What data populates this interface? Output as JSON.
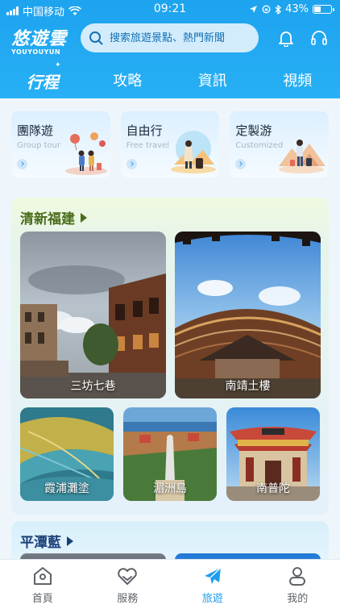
{
  "status_bar": {
    "carrier": "中国移动",
    "time": "09:21",
    "battery": "43%",
    "battery_level": 0.43
  },
  "app": {
    "name": "悠遊雲",
    "sub": "YOUYOUYUN"
  },
  "search": {
    "placeholder": "搜索旅遊景點、熱門新聞"
  },
  "nav": {
    "tabs": [
      "行程",
      "攻略",
      "資訊",
      "視頻"
    ],
    "active": "行程"
  },
  "categories": [
    {
      "title": "團隊遊",
      "subtitle": "Group tour"
    },
    {
      "title": "自由行",
      "subtitle": "Free travel"
    },
    {
      "title": "定製游",
      "subtitle": "Customized"
    }
  ],
  "sections": [
    {
      "title": "清新福建",
      "places": [
        "三坊七巷",
        "南靖土樓",
        "霞浦灘塗",
        "湄洲島",
        "南普陀"
      ]
    },
    {
      "title": "平潭藍"
    }
  ],
  "tabbar": {
    "items": [
      "首頁",
      "服務",
      "旅遊",
      "我的"
    ],
    "active": "旅遊"
  },
  "colors": {
    "header": "#1ea3ef",
    "accent": "#1e9df0",
    "section1_title": "#4a6d1b",
    "section2_title": "#1b3f78"
  }
}
